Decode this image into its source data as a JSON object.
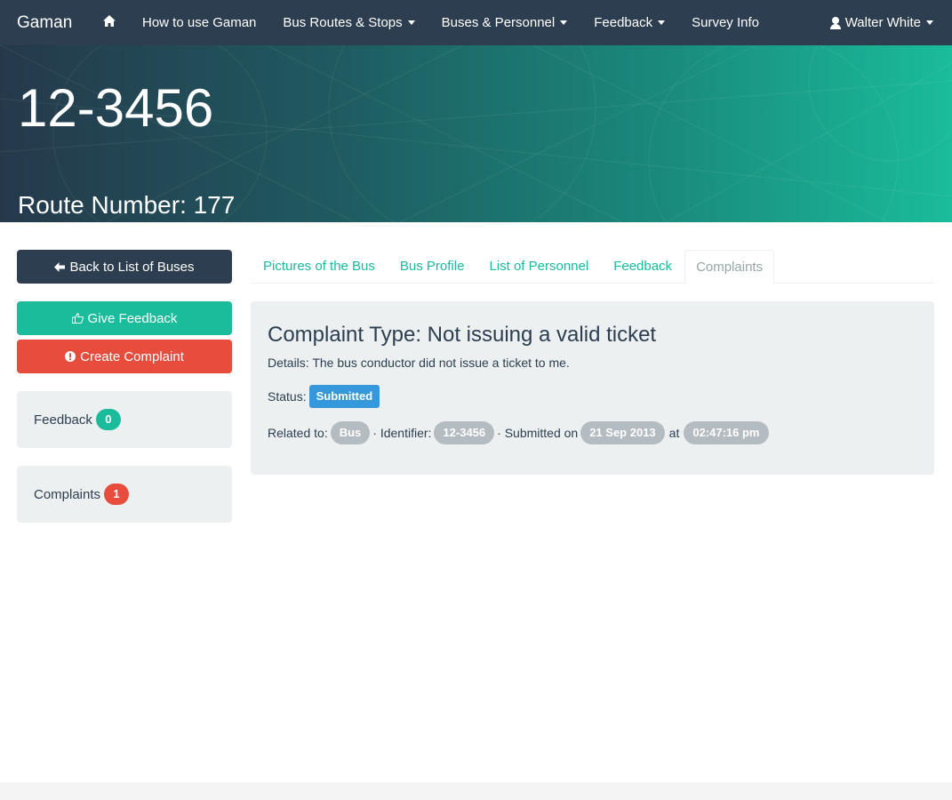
{
  "navbar": {
    "brand": "Gaman",
    "home_icon": "home-icon",
    "items": [
      {
        "label": "How to use Gaman",
        "dropdown": false
      },
      {
        "label": "Bus Routes & Stops",
        "dropdown": true
      },
      {
        "label": "Buses & Personnel",
        "dropdown": true
      },
      {
        "label": "Feedback",
        "dropdown": true
      },
      {
        "label": "Survey Info",
        "dropdown": false
      }
    ],
    "user": "Walter White",
    "user_icon": "user-icon"
  },
  "hero": {
    "title": "12-3456",
    "subtitle": "Route Number: 177"
  },
  "sidebar": {
    "back_button": "Back to List of Buses",
    "back_icon": "arrow-left-icon",
    "give_feedback_button": "Give Feedback",
    "give_feedback_icon": "thumbs-up-icon",
    "create_complaint_button": "Create Complaint",
    "create_complaint_icon": "exclamation-circle-icon",
    "feedback_label": "Feedback",
    "feedback_count": "0",
    "complaints_label": "Complaints",
    "complaints_count": "1"
  },
  "tabs": [
    {
      "label": "Pictures of the Bus",
      "active": false
    },
    {
      "label": "Bus Profile",
      "active": false
    },
    {
      "label": "List of Personnel",
      "active": false
    },
    {
      "label": "Feedback",
      "active": false
    },
    {
      "label": "Complaints",
      "active": true
    }
  ],
  "complaint": {
    "title": "Complaint Type: Not issuing a valid ticket",
    "details": "Details: The bus conductor did not issue a ticket to me.",
    "status_label": "Status:",
    "status_value": "Submitted",
    "related_label": "Related to:",
    "related_value": "Bus",
    "identifier_label": "· Identifier:",
    "identifier_value": "12-3456",
    "submitted_label": "· Submitted on",
    "submitted_date": "21 Sep 2013",
    "at_label": "at",
    "submitted_time": "02:47:16 pm"
  },
  "colors": {
    "navbar": "#2c3e50",
    "accent": "#1abc9c",
    "danger": "#e74c3c",
    "info": "#3498db",
    "well": "#ecf0f1",
    "pill": "#b4bcc2"
  }
}
